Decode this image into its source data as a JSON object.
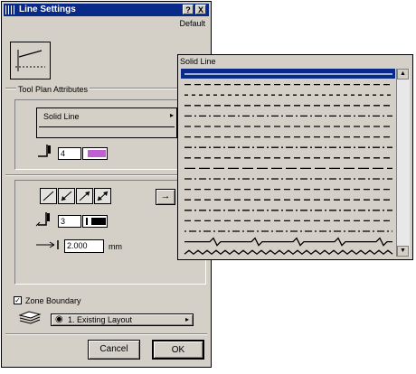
{
  "dialog": {
    "title": "Line Settings",
    "help_label": "?",
    "close_label": "X",
    "default_label": "Default",
    "group_label": "Tool Plan Attributes",
    "line_type": "Solid Line",
    "pen_number": "4",
    "pen_color": "#c060d0",
    "section_pen_number": "3",
    "section_pen_color": "#000000",
    "thickness_value": "2.000",
    "thickness_unit": "mm",
    "zone_boundary_label": "Zone Boundary",
    "zone_boundary_checked": "✓",
    "layer_value": "1. Existing Layout",
    "cancel_label": "Cancel",
    "ok_label": "OK"
  },
  "palette": {
    "title": "Solid Line",
    "selected_index": 0,
    "items": [
      "solid",
      "dash",
      "short-dash",
      "dash",
      "dash-dot",
      "dash",
      "dash",
      "dash-dot",
      "dash",
      "long-dash",
      "dash-dot",
      "dash",
      "dash",
      "dash-dot",
      "dash",
      "dot-dash",
      "zigzag",
      "wave"
    ]
  },
  "icons": {
    "grip": "grip-icon",
    "pen": "pen-icon",
    "arrow": "arrow-right-icon",
    "layer": "layer-stack-icon",
    "eye": "eye-icon"
  }
}
